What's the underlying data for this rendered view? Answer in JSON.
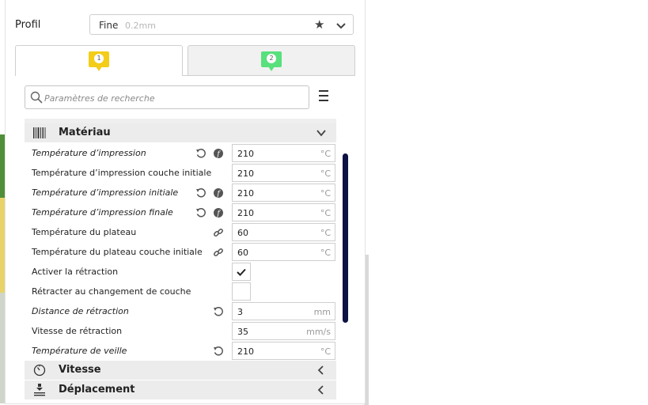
{
  "profile": {
    "label": "Profil",
    "name": "Fine",
    "layer": "0.2mm"
  },
  "tabs": [
    {
      "number": "1",
      "color": "#f3cd1a"
    },
    {
      "number": "2",
      "color": "#58e07c"
    }
  ],
  "search": {
    "placeholder": "Paramètres de recherche"
  },
  "colors": {
    "accent": "#0d1245",
    "category_bg": "#ececec"
  },
  "categories": {
    "material": {
      "title": "Matériau",
      "icon": "material-barcode-icon",
      "state": "expanded"
    },
    "speed": {
      "title": "Vitesse",
      "icon": "speed-gauge-icon",
      "state": "collapsed"
    },
    "travel": {
      "title": "Déplacement",
      "icon": "travel-icon",
      "state": "collapsed"
    }
  },
  "settings": [
    {
      "label": "Température d’impression",
      "italic": true,
      "value": "210",
      "unit": "°C",
      "icons": [
        "reset-icon",
        "function-icon"
      ]
    },
    {
      "label": "Température d’impression couche initiale",
      "italic": false,
      "value": "210",
      "unit": "°C",
      "icons": []
    },
    {
      "label": "Température d’impression initiale",
      "italic": true,
      "value": "210",
      "unit": "°C",
      "icons": [
        "reset-icon",
        "function-icon"
      ]
    },
    {
      "label": "Température d’impression finale",
      "italic": true,
      "value": "210",
      "unit": "°C",
      "icons": [
        "reset-icon",
        "function-icon"
      ]
    },
    {
      "label": "Température du plateau",
      "italic": false,
      "value": "60",
      "unit": "°C",
      "icons": [
        "link-icon"
      ]
    },
    {
      "label": "Température du plateau couche initiale",
      "italic": false,
      "value": "60",
      "unit": "°C",
      "icons": [
        "link-icon"
      ]
    },
    {
      "label": "Activer la rétraction",
      "italic": false,
      "checkbox": true,
      "checked": true
    },
    {
      "label": "Rétracter au changement de couche",
      "italic": false,
      "checkbox": true,
      "checked": false
    },
    {
      "label": "Distance de rétraction",
      "italic": true,
      "value": "3",
      "unit": "mm",
      "icons": [
        "reset-icon"
      ]
    },
    {
      "label": "Vitesse de rétraction",
      "italic": false,
      "value": "35",
      "unit": "mm/s",
      "icons": []
    },
    {
      "label": "Température de veille",
      "italic": true,
      "value": "210",
      "unit": "°C",
      "icons": [
        "reset-icon"
      ]
    }
  ]
}
